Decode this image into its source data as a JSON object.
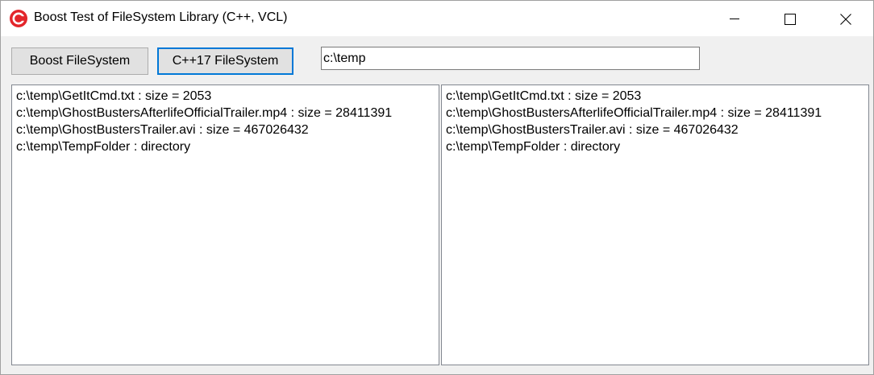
{
  "window": {
    "title": "Boost Test of FileSystem Library (C++, VCL)",
    "app_icon": "cplusplus-builder-icon",
    "controls": [
      "minimize-icon",
      "maximize-icon",
      "close-icon"
    ]
  },
  "toolbar": {
    "boost_label": "Boost FileSystem",
    "cpp17_label": "C++17 FileSystem",
    "path_value": "c:\\temp"
  },
  "left_list": {
    "items": [
      "c:\\temp\\GetItCmd.txt : size = 2053",
      "c:\\temp\\GhostBustersAfterlifeOfficialTrailer.mp4 : size = 28411391",
      "c:\\temp\\GhostBustersTrailer.avi : size = 467026432",
      "c:\\temp\\TempFolder : directory"
    ]
  },
  "right_list": {
    "items": [
      "c:\\temp\\GetItCmd.txt : size = 2053",
      "c:\\temp\\GhostBustersAfterlifeOfficialTrailer.mp4 : size = 28411391",
      "c:\\temp\\GhostBustersTrailer.avi : size = 467026432",
      "c:\\temp\\TempFolder : directory"
    ]
  },
  "colors": {
    "accent": "#0078d7",
    "icon_red": "#e3262b",
    "window_bg": "#f0f0f0"
  }
}
